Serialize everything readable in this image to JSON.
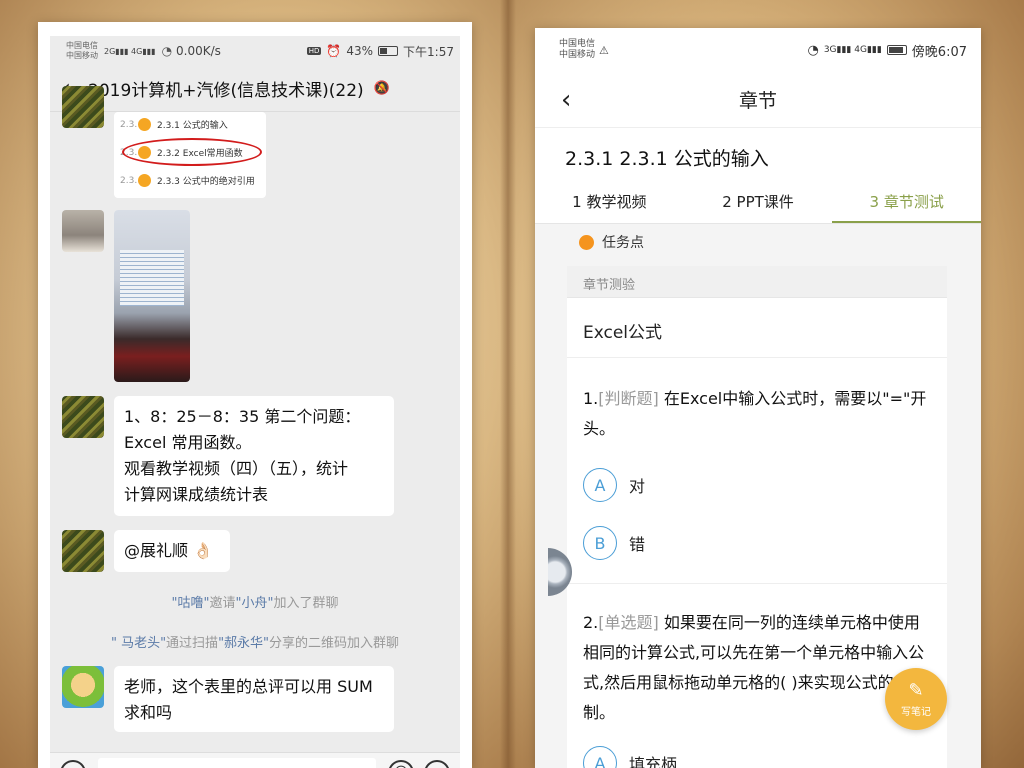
{
  "left_phone": {
    "status": {
      "carrier_1": "中国电信",
      "carrier_2": "中国移动",
      "signal_1": "2G",
      "signal_2": "4G",
      "speed": "0.00K/s",
      "battery": "43%",
      "battery_level": 0.43,
      "time": "下午1:57"
    },
    "header": {
      "title": "2019计算机+汽修(信息技术课)(22)"
    },
    "image_list": [
      {
        "num": "2.3.",
        "label": "2.3.1 公式的输入"
      },
      {
        "num": "2.3.",
        "label": "2.3.2 Excel常用函数"
      },
      {
        "num": "2.3.",
        "label": "2.3.3 公式中的绝对引用"
      }
    ],
    "messages": {
      "msg1_line1": "1、8：25－8：35 第二个问题：",
      "msg1_line2": "Excel 常用函数。",
      "msg1_line3": "观看教学视频（四）（五），统计",
      "msg1_line4": "计算网课成绩统计表",
      "msg2": "@展礼顺 👌🏻",
      "msg3_line1": "老师，这个表里的总评可以用 SUM",
      "msg3_line2": "求和吗"
    },
    "system": {
      "s1_name1": "\"咕噜\"",
      "s1_text": "邀请",
      "s1_name2": "\"小舟\"",
      "s1_tail": "加入了群聊",
      "s2_name1": "\" 马老头\"",
      "s2_text": "通过扫描",
      "s2_name2": "\"郝永华\"",
      "s2_tail": "分享的二维码加入群聊"
    },
    "input": {
      "voice_icon": "voice-icon",
      "emoji_icon": "emoji-icon",
      "plus_icon": "plus-icon"
    }
  },
  "right_phone": {
    "status": {
      "carrier_1": "中国电信",
      "carrier_2": "中国移动",
      "signal_1": "3G",
      "signal_2": "4G",
      "time": "傍晚6:07"
    },
    "header": {
      "title": "章节"
    },
    "subtitle": "2.3.1 2.3.1 公式的输入",
    "tabs": [
      {
        "label": "1 教学视频",
        "active": false
      },
      {
        "label": "2 PPT课件",
        "active": false
      },
      {
        "label": "3 章节测试",
        "active": true
      }
    ],
    "task_label": "任务点",
    "card": {
      "header": "章节测验",
      "title": "Excel公式",
      "q1": {
        "num": "1.",
        "kind": "[判断题]",
        "text_line1": " 在Excel中输入公式时，需要以\"=\"开",
        "text_line2": "头。",
        "options": [
          {
            "letter": "A",
            "text": "对"
          },
          {
            "letter": "B",
            "text": "错"
          }
        ]
      },
      "q2": {
        "num": "2.",
        "kind": "[单选题]",
        "text_line1": " 如果要在同一列的连续单元格中使用",
        "text_line2": "相同的计算公式,可以先在第一个单元格中输入公",
        "text_line3": "式,然后用鼠标拖动单元格的( )来实现公式的复",
        "text_line4": "制。",
        "options": [
          {
            "letter": "A",
            "text": "填充柄"
          }
        ]
      }
    },
    "note_button": "写笔记"
  },
  "colors": {
    "accent_green": "#8aa04a",
    "option_blue": "#4b9ed6",
    "note_orange": "#f3b73e",
    "task_dot": "#f5941e",
    "annotation_red": "#d21c1c"
  }
}
